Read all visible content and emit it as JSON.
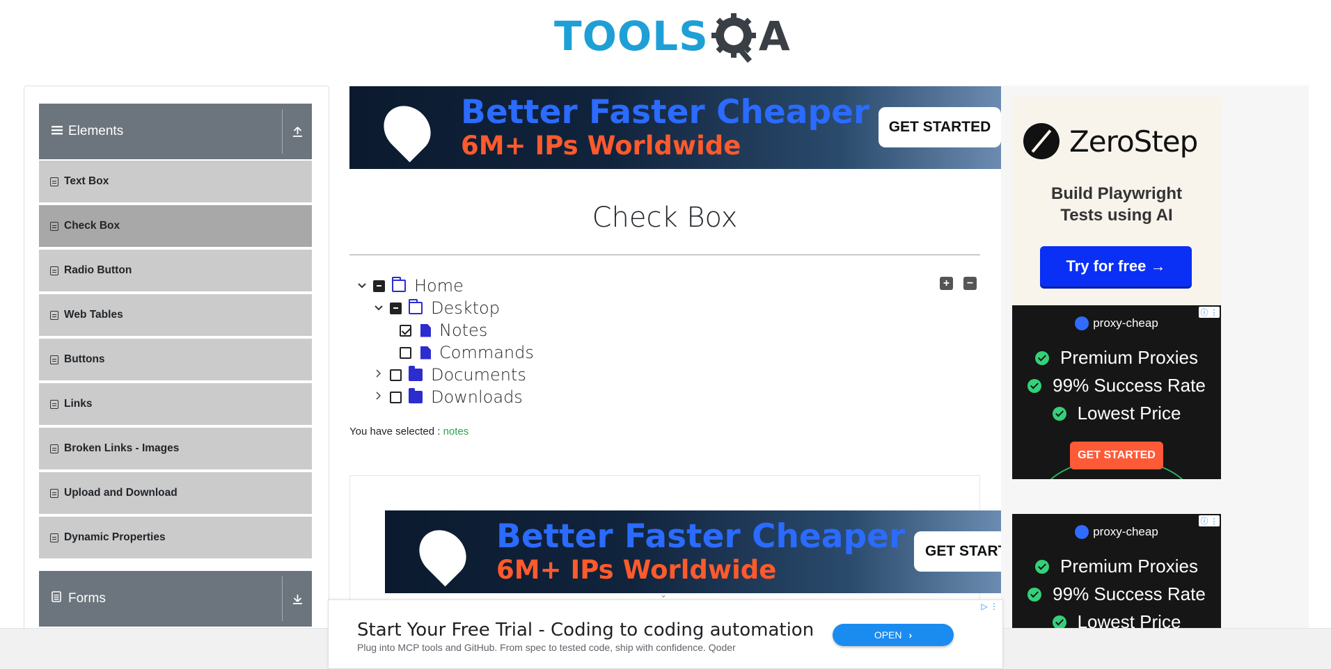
{
  "header": {
    "logo_text": "TOOLS",
    "logo_a": "A"
  },
  "sidebar": {
    "groups": [
      {
        "label": "Elements",
        "icon": "hamburger-icon",
        "toggle_icon": "upload-icon"
      },
      {
        "label": "Forms",
        "icon": "form-icon",
        "toggle_icon": "download-icon"
      }
    ],
    "items": [
      {
        "label": "Text Box"
      },
      {
        "label": "Check Box"
      },
      {
        "label": "Radio Button"
      },
      {
        "label": "Web Tables"
      },
      {
        "label": "Buttons"
      },
      {
        "label": "Links"
      },
      {
        "label": "Broken Links - Images"
      },
      {
        "label": "Upload and Download"
      },
      {
        "label": "Dynamic Properties"
      }
    ],
    "active_item": "Check Box"
  },
  "ads": {
    "top_banner": {
      "line1": "Better Faster Cheaper",
      "line2": "6M+ IPs Worldwide",
      "cta": "GET STARTED"
    },
    "mid_banner": {
      "line1": "Better Faster Cheaper",
      "line2": "6M+ IPs Worldwide",
      "cta": "GET START"
    },
    "zerostep": {
      "name": "ZeroStep",
      "subtitle_line1": "Build Playwright",
      "subtitle_line2": "Tests using AI",
      "cta": "Try for free →"
    },
    "proxy_cheap": {
      "brand": "proxy-cheap",
      "features": [
        "Premium Proxies",
        "99% Success Rate",
        "Lowest Price"
      ],
      "cta": "GET STARTED"
    },
    "bottom": {
      "title": "Start Your Free Trial - Coding to coding automation",
      "description": "Plug into MCP tools and GitHub. From spec to tested code, ship with confidence. Qoder",
      "cta": "OPEN"
    }
  },
  "main": {
    "title": "Check Box",
    "tree": {
      "home": {
        "label": "Home",
        "state": "partial",
        "expanded": true
      },
      "desktop": {
        "label": "Desktop",
        "state": "partial",
        "expanded": true
      },
      "notes": {
        "label": "Notes",
        "state": "checked"
      },
      "commands": {
        "label": "Commands",
        "state": "unchecked"
      },
      "documents": {
        "label": "Documents",
        "state": "unchecked",
        "expanded": false
      },
      "downloads": {
        "label": "Downloads",
        "state": "unchecked",
        "expanded": false
      }
    },
    "expand_all_label": "+",
    "collapse_all_label": "−",
    "result_prefix": "You have selected :",
    "result_values": "notes"
  },
  "colors": {
    "brand_blue": "#1ea0d6",
    "sidebar_header": "#6c757d",
    "sidebar_item": "#cbcbcb",
    "sidebar_active": "#a8a8a8",
    "folder_icon": "#2c2ccf",
    "selected_text": "#28a745"
  }
}
